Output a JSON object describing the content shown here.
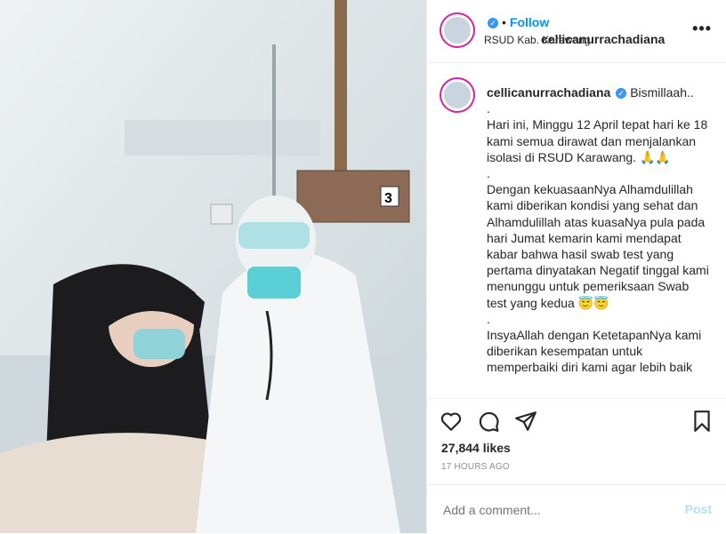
{
  "post": {
    "username": "cellicanurrachadiana",
    "follow_label": "Follow",
    "dot": "•",
    "location": "RSUD Kab. Karawang",
    "more_label": "•••",
    "caption": "Bismillaah..\n.\nHari ini, Minggu 12 April tepat hari ke 18 kami semua dirawat dan menjalankan isolasi di RSUD Karawang. 🙏🙏\n.\nDengan kekuasaanNya Alhamdulillah kami diberikan kondisi yang sehat dan Alhamdulillah atas kuasaNya pula pada hari Jumat kemarin kami mendapat kabar bahwa hasil swab test yang pertama dinyatakan Negatif tinggal kami menunggu untuk pemeriksaan Swab test yang kedua 😇😇\n.\nInsyaAllah dengan KetetapanNya kami diberikan kesempatan untuk memperbaiki diri kami agar lebih baik",
    "likes": "27,844 likes",
    "time": "17 HOURS AGO",
    "comment_placeholder": "Add a comment...",
    "post_label": "Post",
    "bed_number": "3"
  },
  "icons": {
    "like": "heart-icon",
    "comment": "comment-icon",
    "share": "share-icon",
    "save": "bookmark-icon",
    "verified": "verified-badge-icon"
  },
  "colors": {
    "follow": "#0095f6",
    "verified": "#3897f0",
    "post_disabled": "#b2dffc"
  }
}
